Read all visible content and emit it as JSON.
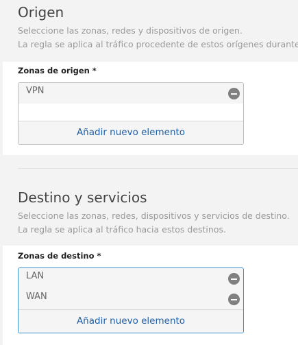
{
  "origin": {
    "title": "Origen",
    "desc1": "Seleccione las zonas, redes y dispositivos de origen.",
    "desc2": "La regla se aplica al tráfico procedente de estos orígenes durante",
    "field_label": "Zonas de origen *",
    "items": [
      "VPN"
    ],
    "add_label": "Añadir nuevo elemento"
  },
  "destination": {
    "title": "Destino y servicios",
    "desc1": "Seleccione las zonas, redes, dispositivos y servicios de destino.",
    "desc2": "La regla se aplica al tráfico hacia estos destinos.",
    "field_label": "Zonas de destino *",
    "items": [
      "LAN",
      "WAN"
    ],
    "add_label": "Añadir nuevo elemento"
  },
  "icons": {
    "remove": "minus-circle-icon"
  },
  "colors": {
    "link": "#1e5fa8",
    "focus_border": "#3c8fd0",
    "remove_icon": "#808080"
  }
}
